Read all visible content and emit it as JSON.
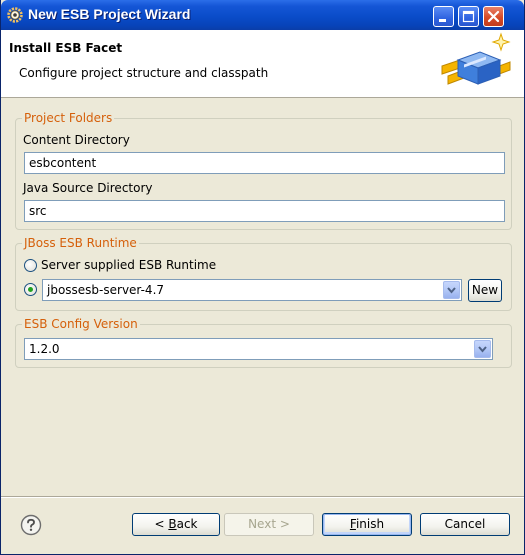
{
  "window": {
    "title": "New ESB Project Wizard"
  },
  "header": {
    "title": "Install ESB Facet",
    "description": "Configure project structure and classpath"
  },
  "project_folders": {
    "legend": "Project Folders",
    "content_dir_label": "Content Directory",
    "content_dir_value": "esbcontent",
    "java_src_label": "Java Source Directory",
    "java_src_value": "src"
  },
  "runtime": {
    "legend": "JBoss ESB Runtime",
    "option_server_supplied": "Server supplied ESB Runtime",
    "selected_runtime": "jbossesb-server-4.7",
    "new_button": "New"
  },
  "config_version": {
    "legend": "ESB Config Version",
    "selected": "1.2.0"
  },
  "footer": {
    "back_prefix": "< ",
    "back_mnemonic": "B",
    "back_rest": "ack",
    "next": "Next >",
    "finish_mnemonic": "F",
    "finish_rest": "inish",
    "cancel": "Cancel"
  },
  "colors": {
    "title_bar": "#0a4cc9",
    "group_legend": "#d5600b",
    "dialog_bg": "#ece9d8"
  },
  "icons": {
    "title": "eclipse-gear-icon",
    "banner": "esb-wizard-banner-icon",
    "help": "help-icon"
  }
}
